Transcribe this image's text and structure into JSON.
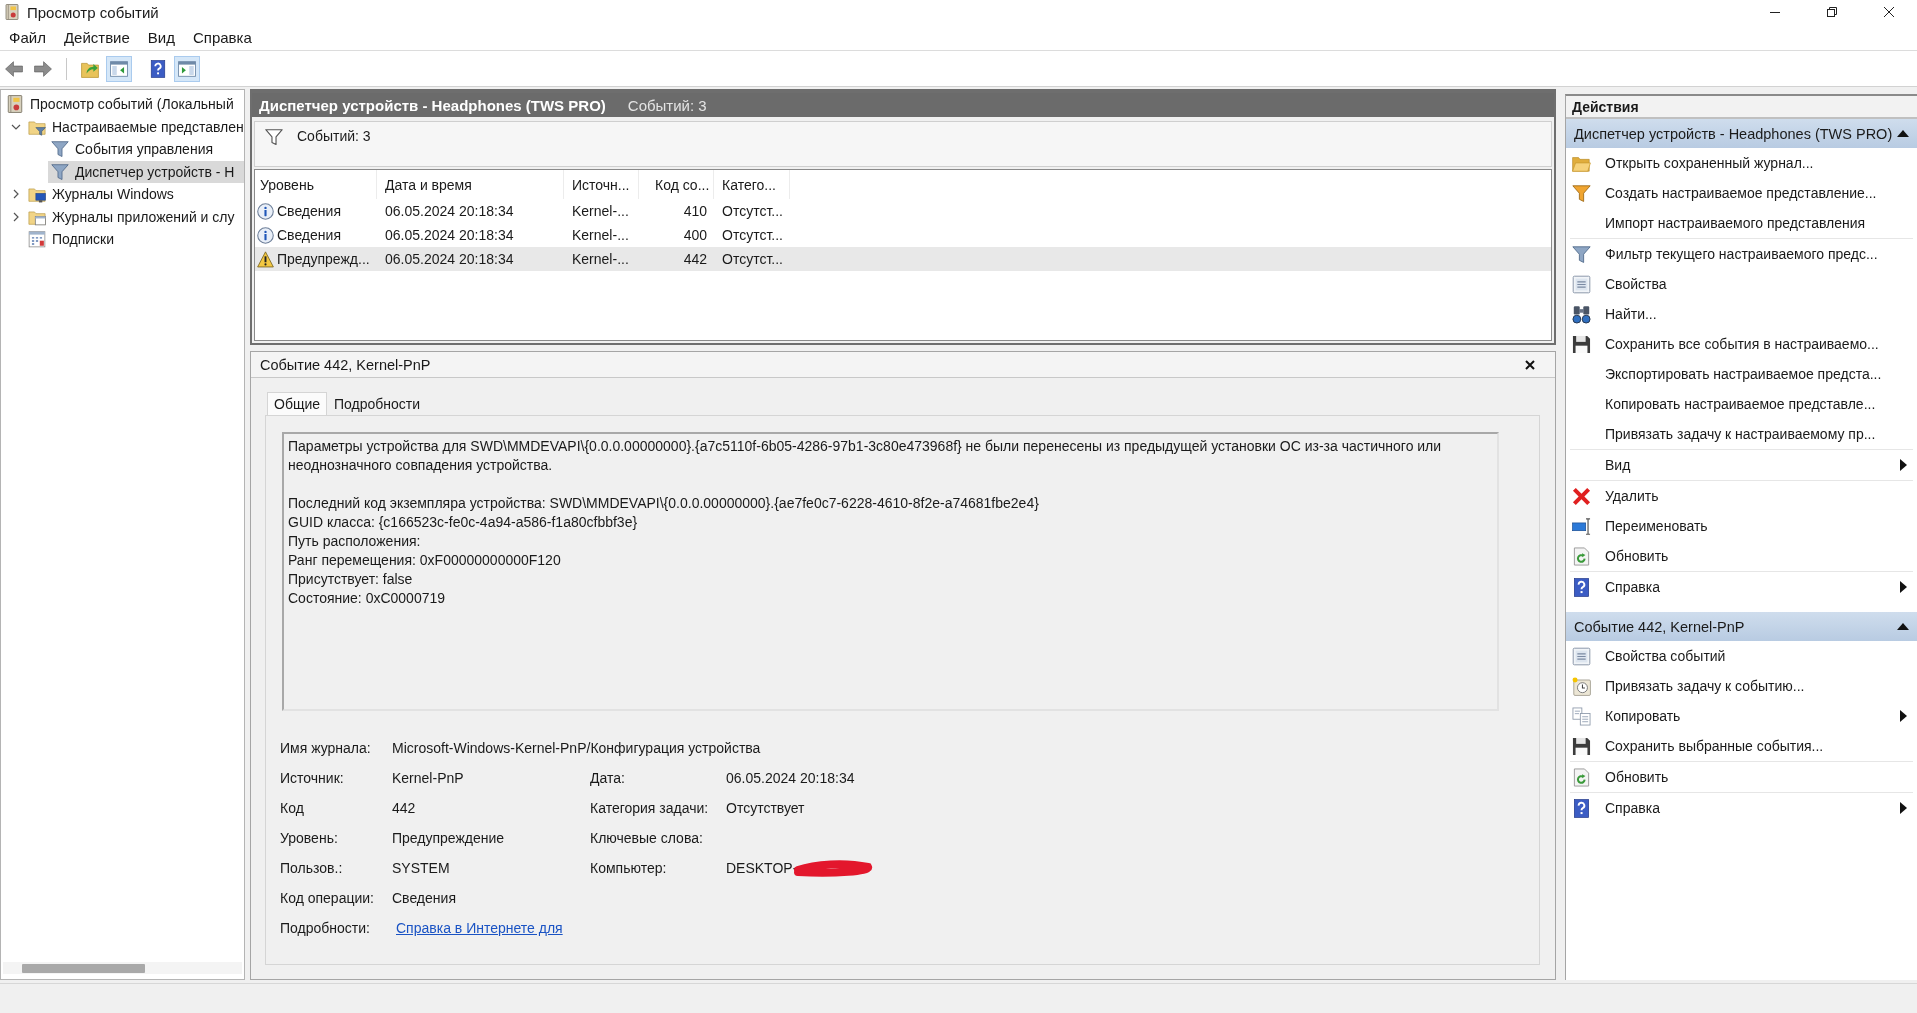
{
  "window": {
    "title": "Просмотр событий"
  },
  "menu": [
    {
      "label": "Файл"
    },
    {
      "label": "Действие"
    },
    {
      "label": "Вид"
    },
    {
      "label": "Справка"
    }
  ],
  "toolbar": [
    {
      "kind": "back",
      "pressed": false
    },
    {
      "kind": "forward",
      "pressed": false
    },
    {
      "kind": "folder-up",
      "pressed": false
    },
    {
      "kind": "tree-pane",
      "pressed": true
    },
    {
      "kind": "help",
      "pressed": false
    },
    {
      "kind": "action-pane",
      "pressed": true
    }
  ],
  "tree": [
    {
      "label": "Просмотр событий (Локальный",
      "kind": "viewer",
      "selected": false,
      "children": [
        {
          "label": "Настраиваемые представлен",
          "kind": "views-folder",
          "expanded": true,
          "selected": false,
          "children": [
            {
              "label": "События управления",
              "kind": "filter",
              "selected": false
            },
            {
              "label": "Диспетчер устройств - H",
              "kind": "filter",
              "selected": true
            }
          ]
        },
        {
          "label": "Журналы Windows",
          "kind": "windows-folder",
          "expanded": false,
          "selected": false
        },
        {
          "label": "Журналы приложений и слу",
          "kind": "app-folder",
          "expanded": false,
          "selected": false
        },
        {
          "label": "Подписки",
          "kind": "subscriptions",
          "selected": false
        }
      ]
    }
  ],
  "events_pane": {
    "title": "Диспетчер устройств - Headphones (TWS PRO)",
    "count": "Событий: 3",
    "filter_count": "Событий: 3",
    "columns": [
      "Уровень",
      "Дата и время",
      "Источн...",
      "Код со...",
      "Катего..."
    ],
    "rows": [
      {
        "kind": "info",
        "severity": "Сведения",
        "datetime": "06.05.2024 20:18:34",
        "source": "Kernel-...",
        "event_id": "410",
        "category": "Отсутст...",
        "selected": false
      },
      {
        "kind": "info",
        "severity": "Сведения",
        "datetime": "06.05.2024 20:18:34",
        "source": "Kernel-...",
        "event_id": "400",
        "category": "Отсутст...",
        "selected": false
      },
      {
        "kind": "warning",
        "severity": "Предупрежд...",
        "datetime": "06.05.2024 20:18:34",
        "source": "Kernel-...",
        "event_id": "442",
        "category": "Отсутст...",
        "selected": true
      }
    ]
  },
  "event_pane": {
    "title": "Событие 442, Kernel-PnP",
    "tabs": [
      {
        "label": "Общие",
        "selected": true
      },
      {
        "label": "Подробности",
        "selected": false
      }
    ],
    "message": [
      [
        "Параметры устройства для SWD\\MMDEVAPI\\{0.0.0.00000000}.{a7c5110f-6b05-4286-97b1-3c80e473968f} не были перенесены из предыдущей установки ОС из-за частичного или неоднозначного совпадения устройства."
      ],
      [
        "Последний код экземпляра устройства: SWD\\MMDEVAPI\\{0.0.0.00000000}.{ae7fe0c7-6228-4610-8f2e-a74681fbe2e4}",
        "GUID класса: {c166523c-fe0c-4a94-a586-f1a80cfbbf3e}",
        "Путь расположения:",
        "Ранг перемещения: 0xF00000000000F120",
        "Присутствует: false",
        "Состояние: 0xC0000719"
      ]
    ],
    "fields": [
      [
        {
          "label": "Имя журнала:",
          "value": "Microsoft-Windows-Kernel-PnP/Конфигурация устройства"
        }
      ],
      [
        {
          "label": "Источник:",
          "value": "Kernel-PnP"
        },
        {
          "label": "Дата:",
          "value": "06.05.2024 20:18:34"
        }
      ],
      [
        {
          "label": "Код",
          "value": "442"
        },
        {
          "label": "Категория задачи:",
          "value": "Отсутствует"
        }
      ],
      [
        {
          "label": "Уровень:",
          "value": "Предупреждение"
        },
        {
          "label": "Ключевые слова:"
        }
      ],
      [
        {
          "label": "Пользов.:",
          "value": "SYSTEM"
        },
        {
          "label": "Компьютер:",
          "value": "DESKTOP-",
          "redacted": true
        }
      ],
      [
        {
          "label": "Код операции:",
          "value": "Сведения"
        }
      ],
      [
        {
          "label": "Подробности:",
          "link": "Справка в Интернете для"
        }
      ]
    ]
  },
  "actions": {
    "title": "Действия",
    "sections": [
      {
        "title": "Диспетчер устройств - Headphones (TWS PRO)",
        "expanded": true,
        "groups": [
          [
            {
              "label": "Открыть сохраненный журнал...",
              "kind": "open-log",
              "submenu": false
            },
            {
              "label": "Создать настраиваемое представление...",
              "kind": "new-view",
              "submenu": false
            },
            {
              "label": "Импорт настраиваемого представления",
              "submenu": false
            }
          ],
          [
            {
              "label": "Фильтр текущего настраиваемого предс...",
              "kind": "filter",
              "submenu": false
            },
            {
              "label": "Свойства",
              "kind": "properties",
              "submenu": false
            },
            {
              "label": "Найти...",
              "kind": "find",
              "submenu": false
            },
            {
              "label": "Сохранить все события в настраиваемо...",
              "kind": "save",
              "submenu": false
            },
            {
              "label": "Экспортировать настраиваемое предста...",
              "submenu": false
            },
            {
              "label": "Копировать настраиваемое представле...",
              "submenu": false
            },
            {
              "label": "Привязать задачу к настраиваемому пр...",
              "submenu": false
            }
          ],
          [
            {
              "label": "Вид",
              "submenu": true
            }
          ],
          [
            {
              "label": "Удалить",
              "kind": "delete",
              "submenu": false
            },
            {
              "label": "Переименовать",
              "kind": "rename",
              "submenu": false
            },
            {
              "label": "Обновить",
              "kind": "refresh",
              "submenu": false
            }
          ],
          [
            {
              "label": "Справка",
              "kind": "help",
              "submenu": true
            }
          ]
        ]
      },
      {
        "title": "Событие 442, Kernel-PnP",
        "expanded": true,
        "groups": [
          [
            {
              "label": "Свойства событий",
              "kind": "properties",
              "submenu": false
            },
            {
              "label": "Привязать задачу к событию...",
              "kind": "attach-task",
              "submenu": false
            },
            {
              "label": "Копировать",
              "kind": "copy",
              "submenu": true
            },
            {
              "label": "Сохранить выбранные события...",
              "kind": "save",
              "submenu": false
            }
          ],
          [
            {
              "label": "Обновить",
              "kind": "refresh",
              "submenu": false
            }
          ],
          [
            {
              "label": "Справка",
              "kind": "help",
              "submenu": true
            }
          ]
        ]
      }
    ]
  }
}
